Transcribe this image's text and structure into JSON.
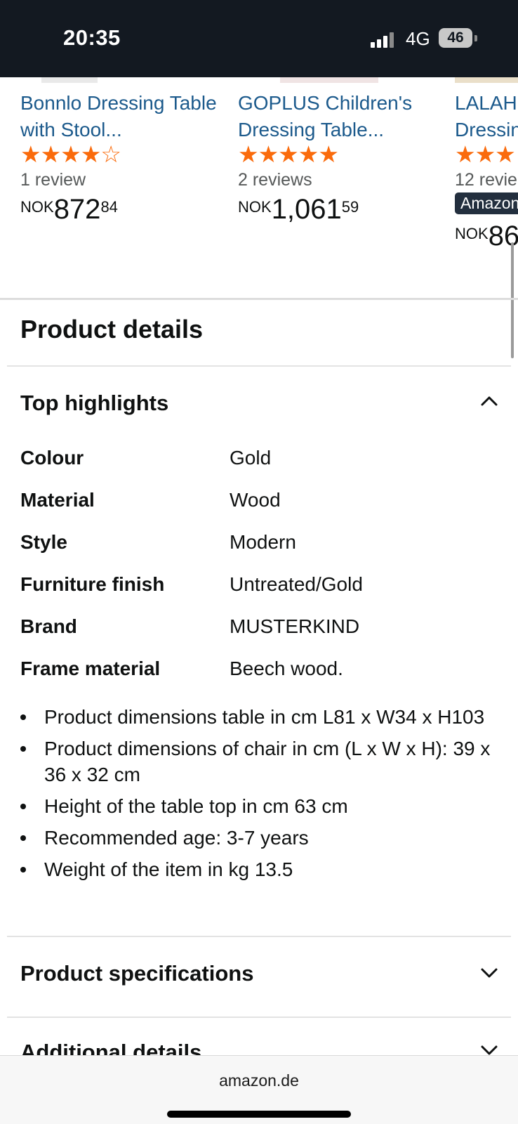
{
  "status_bar": {
    "time": "20:35",
    "network": "4G",
    "battery": "46"
  },
  "carousel": {
    "items": [
      {
        "title": "Bonnlo Dressing Table with Stool...",
        "rating": 4,
        "stars_display": "★★★★☆",
        "reviews": "1 review",
        "currency": "NOK",
        "price_whole": "872",
        "price_fraction": "84"
      },
      {
        "title": "GOPLUS Children's Dressing Table...",
        "rating": 5,
        "stars_display": "★★★★★",
        "reviews": "2 reviews",
        "currency": "NOK",
        "price_whole": "1,061",
        "price_fraction": "59"
      },
      {
        "title": "LALAH Dressin",
        "rating": 3,
        "stars_display": "★★★",
        "reviews": "12 revie",
        "badge": "Amazon",
        "currency": "NOK",
        "price_whole": "86",
        "price_fraction": ""
      }
    ]
  },
  "product_details": {
    "heading": "Product details",
    "top_highlights": {
      "title": "Top highlights",
      "rows": [
        {
          "key": "Colour",
          "value": "Gold"
        },
        {
          "key": "Material",
          "value": "Wood"
        },
        {
          "key": "Style",
          "value": "Modern"
        },
        {
          "key": "Furniture finish",
          "value": "Untreated/Gold"
        },
        {
          "key": "Brand",
          "value": "MUSTERKIND"
        },
        {
          "key": "Frame material",
          "value": "Beech wood."
        }
      ],
      "bullets": [
        "Product dimensions table in cm L81 x W34 x H103",
        "Product dimensions of chair in cm (L x W x H): 39 x 36 x 32 cm",
        "Height of the table top in cm 63 cm",
        "Recommended age: 3-7 years",
        "Weight of the item in kg 13.5"
      ]
    },
    "product_specifications": {
      "title": "Product specifications"
    },
    "additional_details": {
      "title": "Additional details"
    }
  },
  "browser": {
    "url": "amazon.de"
  }
}
